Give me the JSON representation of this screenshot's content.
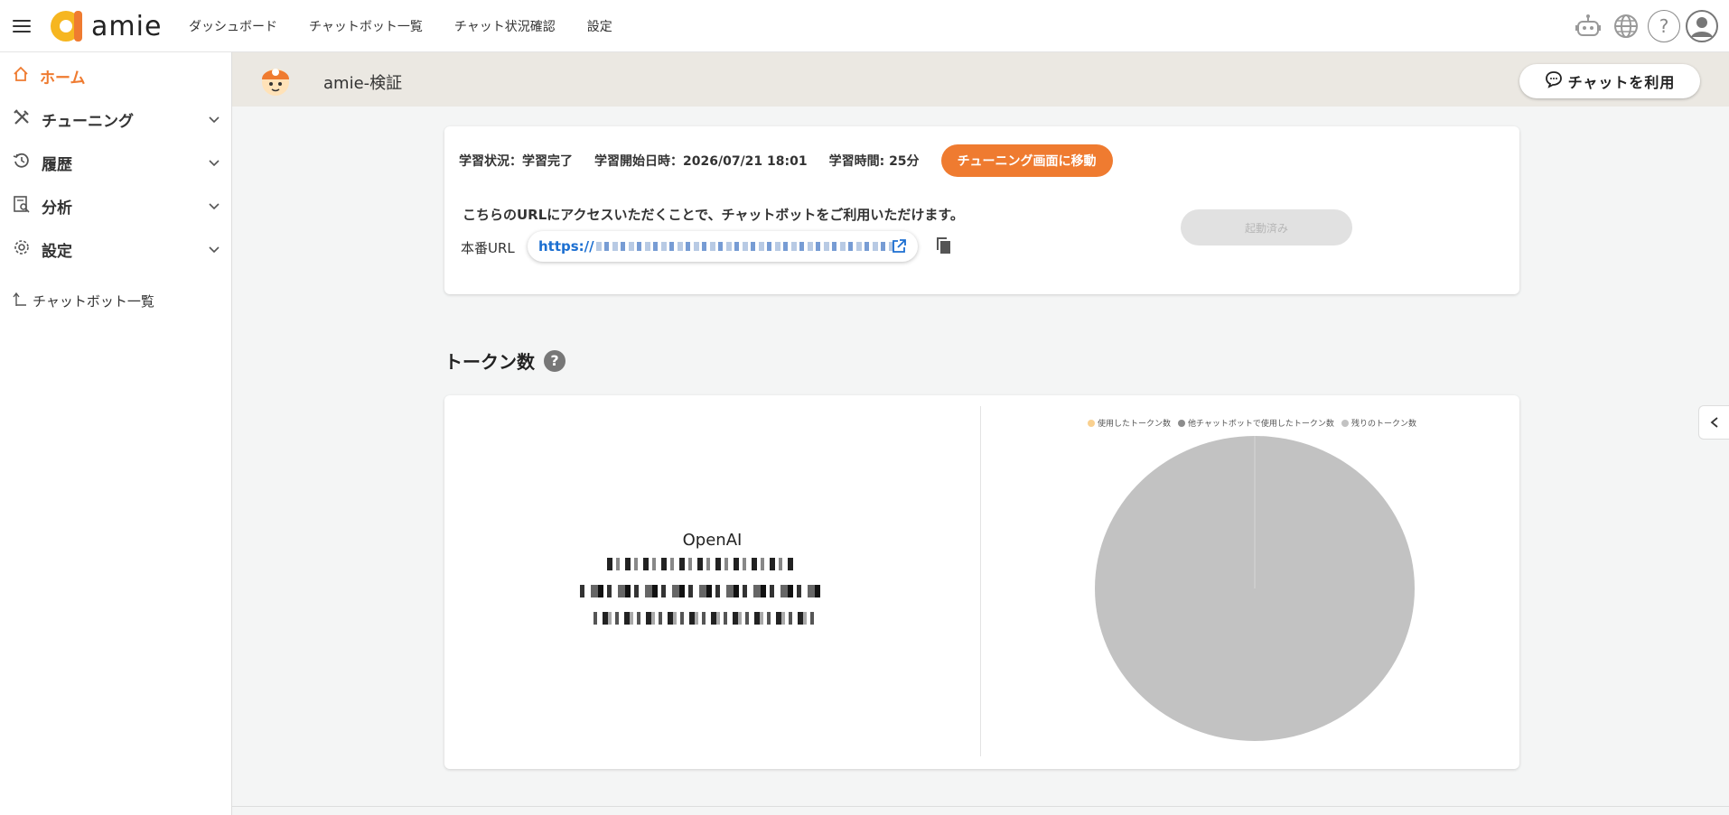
{
  "header": {
    "logo_text": "amie",
    "nav": [
      "ダッシュボード",
      "チャットボット一覧",
      "チャット状況確認",
      "設定"
    ]
  },
  "sidebar": {
    "items": [
      {
        "label": "ホーム",
        "icon": "home-icon",
        "active": true
      },
      {
        "label": "チューニング",
        "icon": "tools-icon"
      },
      {
        "label": "履歴",
        "icon": "history-icon"
      },
      {
        "label": "分析",
        "icon": "analysis-icon"
      },
      {
        "label": "設定",
        "icon": "gear-icon"
      }
    ],
    "back_label": "チャットボット一覧"
  },
  "subheader": {
    "bot_name": "amie-検証",
    "chat_button": "チャットを利用"
  },
  "status": {
    "state": "学習状況：学習完了",
    "start": "学習開始日時：2026/07/21 18:01",
    "duration": "学習時間: 25分",
    "tune_button": "チューニング画面に移動",
    "url_description": "こちらのURLにアクセスいただくことで、チャットボットをご利用いただけます。",
    "url_label": "本番URL",
    "url_prefix": "https://",
    "start_button": "起動済み"
  },
  "tokens": {
    "title": "トークン数",
    "provider": "OpenAI",
    "legend": [
      "使用したトークン数",
      "他チャットボットで使用したトークン数",
      "残りのトークン数"
    ],
    "colors": {
      "used": "#f9d08f",
      "other": "#8c8c8c",
      "remaining": "#c2c2c2",
      "accent": "#ef7b30"
    }
  }
}
